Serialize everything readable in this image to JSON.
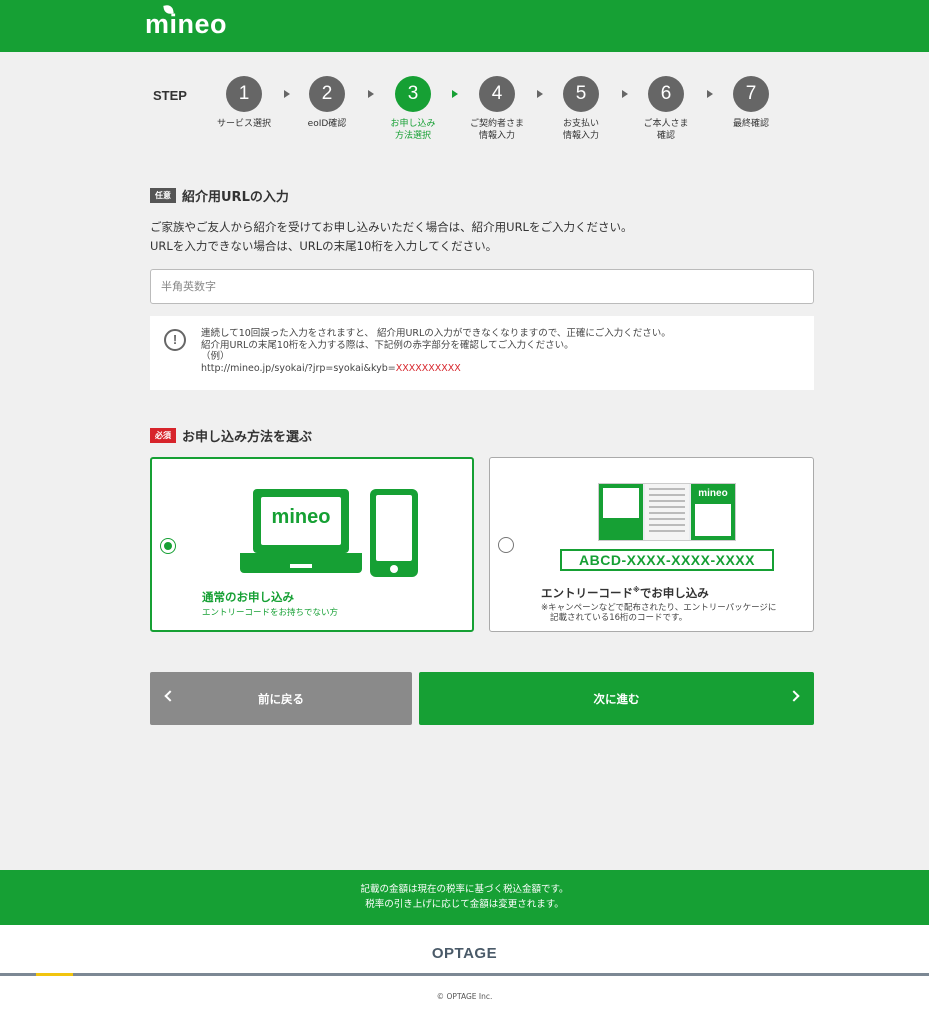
{
  "header": {
    "logo": "mineo"
  },
  "steps": {
    "label": "STEP",
    "items": [
      {
        "num": "1",
        "name": "サービス選択",
        "active": false
      },
      {
        "num": "2",
        "name": "eoID確認",
        "active": false
      },
      {
        "num": "3",
        "name": "お申し込み\n方法選択",
        "active": true
      },
      {
        "num": "4",
        "name": "ご契約者さま\n情報入力",
        "active": false
      },
      {
        "num": "5",
        "name": "お支払い\n情報入力",
        "active": false
      },
      {
        "num": "6",
        "name": "ご本人さま\n確認",
        "active": false
      },
      {
        "num": "7",
        "name": "最終確認",
        "active": false
      }
    ]
  },
  "referral": {
    "badge": "任意",
    "title": "紹介用URLの入力",
    "desc_line1": "ご家族やご友人から紹介を受けてお申し込みいただく場合は、紹介用URLをご入力ください。",
    "desc_line2": "URLを入力できない場合は、URLの末尾10桁を入力してください。",
    "placeholder": "半角英数字",
    "notice_icon": "exclamation-circle-icon",
    "notice_line1": "連続して10回誤った入力をされますと、 紹介用URLの入力ができなくなりますので、正確にご入力ください。",
    "notice_line2": "紹介用URLの末尾10桁を入力する際は、下記例の赤字部分を確認してご入力ください。",
    "notice_example_label": "（例）",
    "notice_example_url": "http://mineo.jp/syokai/?jrp=syokai&kyb=",
    "notice_example_code": "XXXXXXXXXX"
  },
  "method": {
    "badge": "必須",
    "title": "お申し込み方法を選ぶ",
    "normal": {
      "screen_logo": "mineo",
      "title": "通常のお申し込み",
      "sub": "エントリーコードをお持ちでない方",
      "selected": true
    },
    "entry": {
      "pkg_brand": "mineo",
      "code_sample": "ABCD-XXXX-XXXX-XXXX",
      "title_main": "エントリーコード",
      "title_mark": "※",
      "title_rest": "でお申し込み",
      "sub_line1": "※キャンペーンなどで配布されたり、エントリーパッケージに",
      "sub_line2": "記載されている16桁のコードです。",
      "selected": false
    }
  },
  "buttons": {
    "back": "前に戻る",
    "next": "次に進む"
  },
  "footer": {
    "tax_line1": "記載の金額は現在の税率に基づく税込金額です。",
    "tax_line2": "税率の引き上げに応じて金額は変更されます。",
    "brand": "OPTAGE",
    "copyright": "© OPTAGE Inc."
  },
  "colors": {
    "brand_green": "#16a034",
    "required_red": "#d7242b",
    "gray_button": "#8a8a8a"
  }
}
